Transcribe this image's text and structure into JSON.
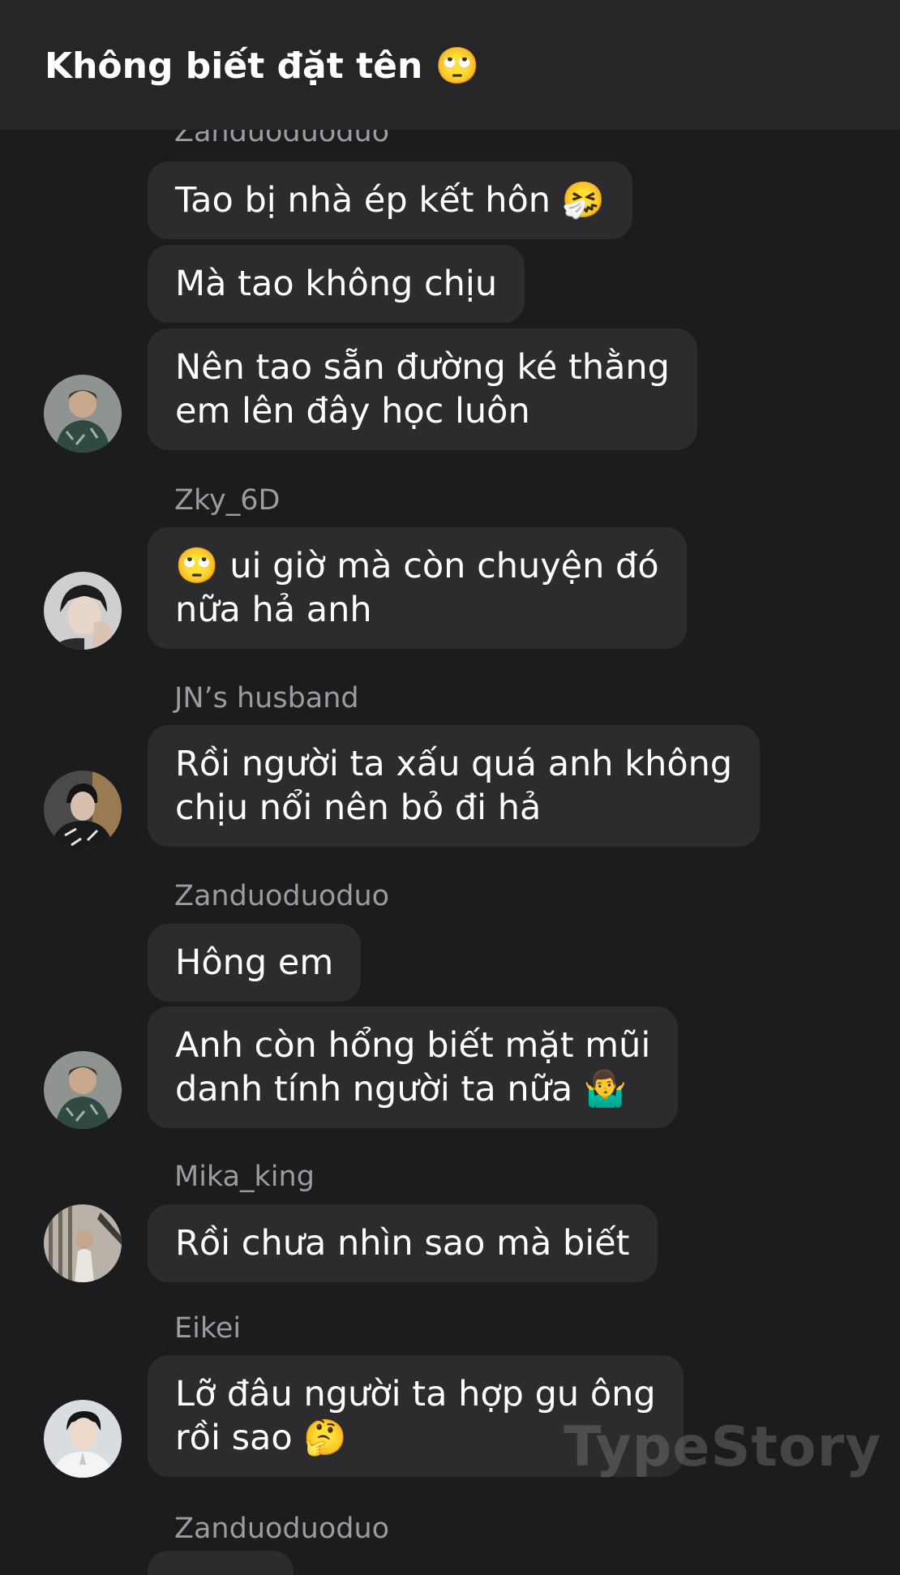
{
  "header": {
    "title": "Không biết đặt tên 🙄"
  },
  "messages": {
    "sender_top_cut": "Zanduoduoduo",
    "m1": "Tao bị nhà ép kết hôn 🤧",
    "m2": "Mà tao không chịu",
    "m3": "Nên tao sẵn đường ké thằng\nem lên đây học luôn",
    "sender_zky": "Zky_6D",
    "m4": "🙄 ui giờ mà còn chuyện đó\nnữa hả anh",
    "sender_jn": "JN’s husband",
    "m5": "Rồi người ta xấu quá anh không\nchịu nổi nên bỏ đi hả",
    "sender_zan2": "Zanduoduoduo",
    "m6": "Hông em",
    "m7": "Anh còn hổng biết mặt mũi\ndanh tính người ta nữa 🤷‍♂️",
    "sender_mika": "Mika_king",
    "m8": "Rồi chưa nhìn sao mà biết",
    "sender_eikei": "Eikei",
    "m9": "Lỡ đâu người ta hợp gu ông\nrồi sao 🤔",
    "sender_zan3": "Zanduoduoduo"
  },
  "watermark": "TypeStory"
}
